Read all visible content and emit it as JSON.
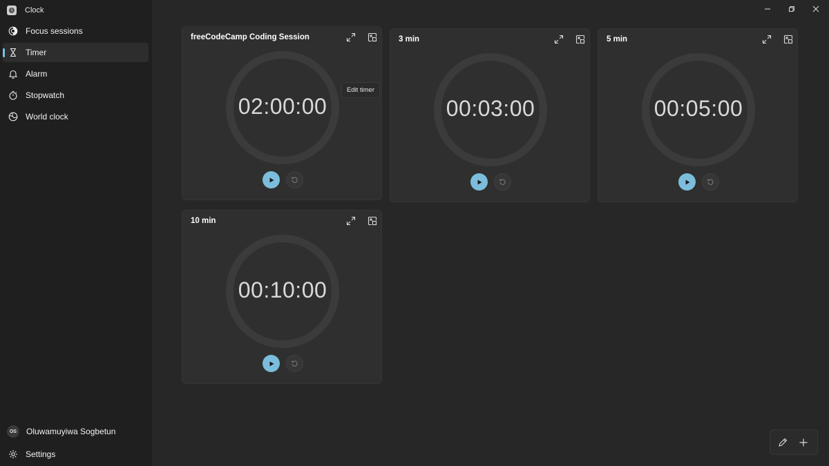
{
  "app": {
    "title": "Clock"
  },
  "sidebar": {
    "items": [
      {
        "label": "Focus sessions",
        "icon": "focus-icon"
      },
      {
        "label": "Timer",
        "icon": "hourglass-icon",
        "active": true
      },
      {
        "label": "Alarm",
        "icon": "bell-icon"
      },
      {
        "label": "Stopwatch",
        "icon": "stopwatch-icon"
      },
      {
        "label": "World clock",
        "icon": "globe-icon"
      }
    ],
    "user": {
      "initials": "OS",
      "name": "Oluwamuyiwa Sogbetun"
    },
    "settings_label": "Settings"
  },
  "timers": [
    {
      "title": "freeCodeCamp Coding Session",
      "time": "02:00:00"
    },
    {
      "title": "3 min",
      "time": "00:03:00"
    },
    {
      "title": "5 min",
      "time": "00:05:00"
    },
    {
      "title": "10 min",
      "time": "00:10:00"
    }
  ],
  "tooltip": {
    "text": "Edit timer"
  },
  "colors": {
    "accent": "#7cbddc",
    "background": "#272727",
    "sidebar": "#1f1f1f",
    "card": "#2f2f2f"
  }
}
